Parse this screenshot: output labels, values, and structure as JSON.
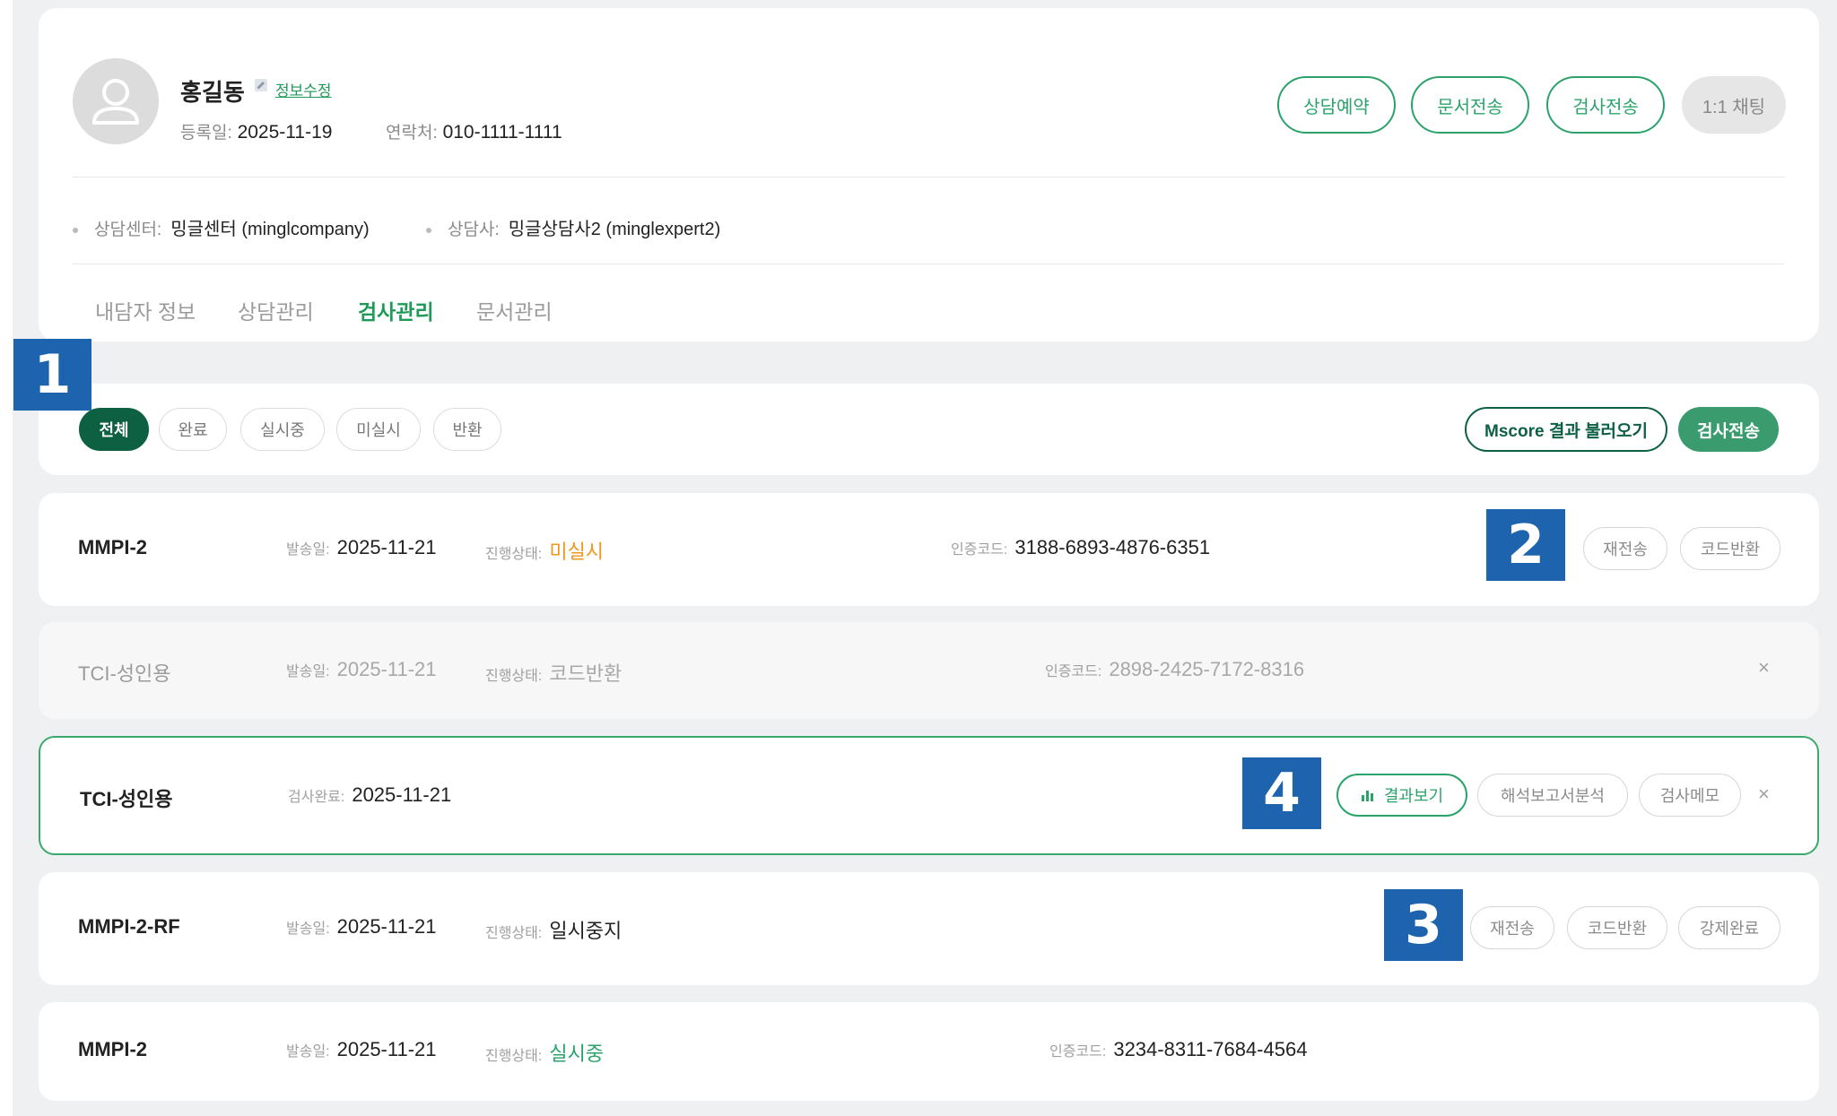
{
  "profile": {
    "name": "홍길동",
    "edit_link": "정보수정",
    "reg_label": "등록일:",
    "reg_date": "2025-11-19",
    "phone_label": "연락처:",
    "phone": "010-1111-1111",
    "center_label": "상담센터:",
    "center": "밍글센터 (minglcompany)",
    "counselor_label": "상담사:",
    "counselor": "밍글상담사2 (minglexpert2)",
    "buttons": [
      "상담예약",
      "문서전송",
      "검사전송",
      "1:1 채팅"
    ]
  },
  "tabs": [
    "내담자 정보",
    "상담관리",
    "검사관리",
    "문서관리"
  ],
  "active_tab": "검사관리",
  "filters": {
    "pills": [
      "전체",
      "완료",
      "실시중",
      "미실시",
      "반환"
    ],
    "active": "전체",
    "mscore_label": "Mscore 결과 불러오기",
    "send_label": "검사전송"
  },
  "labels": {
    "sent_date": "발송일:",
    "status": "진행상태:",
    "auth_code": "인증코드:",
    "completed": "검사완료:"
  },
  "rows": [
    {
      "name": "MMPI-2",
      "date": "2025-11-21",
      "status": "미실시",
      "code": "3188-6893-4876-6351",
      "buttons": [
        "재전송",
        "코드반환"
      ]
    },
    {
      "name": "TCI-성인용",
      "date": "2025-11-21",
      "status": "코드반환",
      "code": "2898-2425-7172-8316"
    },
    {
      "name": "TCI-성인용",
      "completed_date": "2025-11-21",
      "buttons": [
        "결과보기",
        "해석보고서분석",
        "검사메모"
      ]
    },
    {
      "name": "MMPI-2-RF",
      "date": "2025-11-21",
      "status": "일시중지",
      "buttons": [
        "재전송",
        "코드반환",
        "강제완료"
      ]
    },
    {
      "name": "MMPI-2",
      "date": "2025-11-21",
      "status": "실시중",
      "code": "3234-8311-7684-4564"
    }
  ],
  "badges": [
    "1",
    "2",
    "3",
    "4"
  ],
  "close_glyph": "×",
  "colors": {
    "accent_green": "#2aa36b",
    "dark_green": "#0e6043",
    "status_orange": "#f2971e",
    "badge_blue": "#1d63ad"
  }
}
